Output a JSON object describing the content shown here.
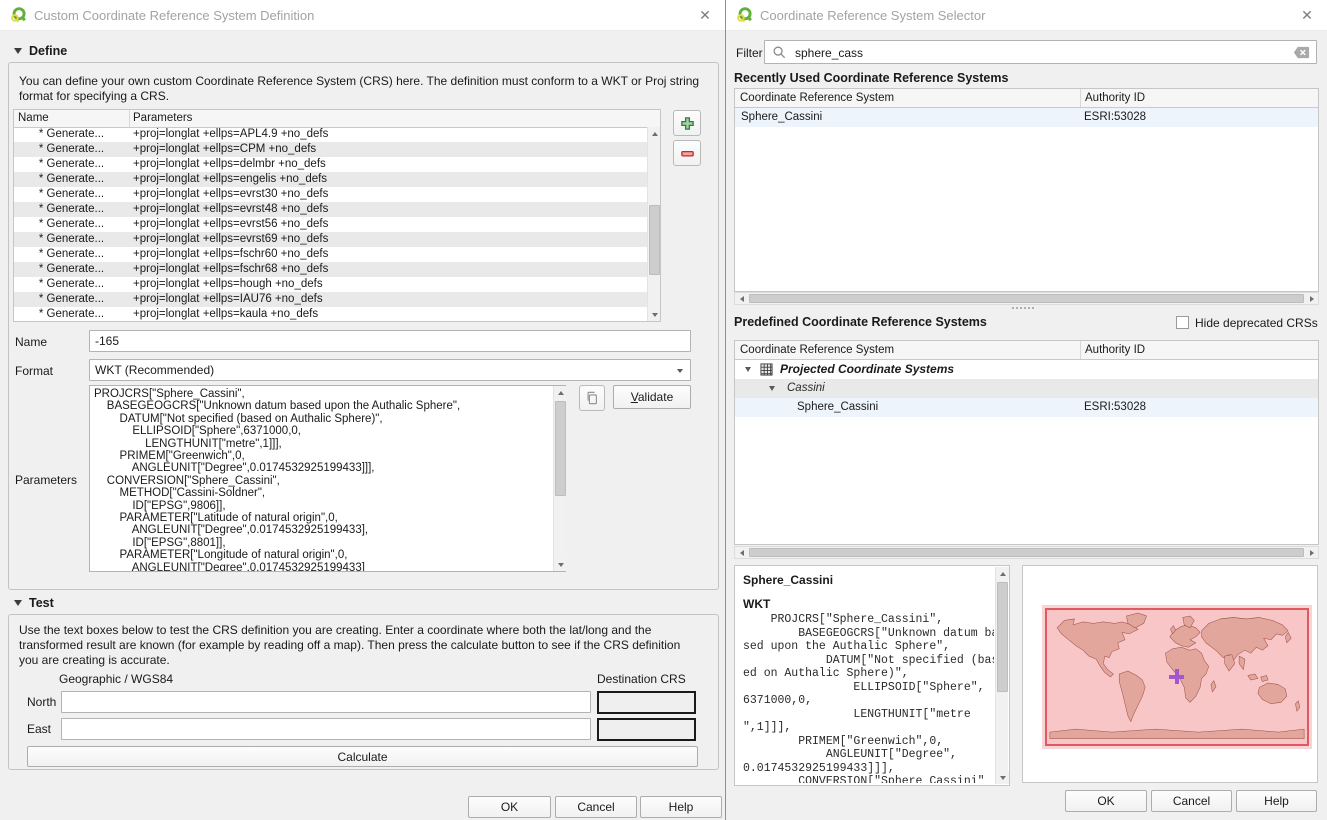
{
  "colors": {
    "qgis_green": "#60b03c",
    "qgis_yellow": "#e8d83a",
    "add_green": "#357a38",
    "remove_red": "#c62828",
    "selection_blue": "#eef4fb",
    "map_ocean_pink": "#f8c6c6",
    "map_land_pink": "#e2a69d",
    "map_border": "#9a4f46",
    "map_frame_red": "#e0595e",
    "crosshair_purple": "#a356cf"
  },
  "icons": {
    "close_glyph": "✕"
  },
  "left_dialog": {
    "title": "Custom Coordinate Reference System Definition",
    "define": {
      "header": "Define",
      "description": "You can define your own custom Coordinate Reference System (CRS) here. The definition must conform to a WKT or Proj string format for specifying a CRS.",
      "columns": [
        "Name",
        "Parameters"
      ],
      "rows": [
        {
          "name": "* Generate...",
          "parameters": "+proj=longlat +ellps=APL4.9 +no_defs"
        },
        {
          "name": "* Generate...",
          "parameters": "+proj=longlat +ellps=CPM +no_defs"
        },
        {
          "name": "* Generate...",
          "parameters": "+proj=longlat +ellps=delmbr +no_defs"
        },
        {
          "name": "* Generate...",
          "parameters": "+proj=longlat +ellps=engelis +no_defs"
        },
        {
          "name": "* Generate...",
          "parameters": "+proj=longlat +ellps=evrst30 +no_defs"
        },
        {
          "name": "* Generate...",
          "parameters": "+proj=longlat +ellps=evrst48 +no_defs"
        },
        {
          "name": "* Generate...",
          "parameters": "+proj=longlat +ellps=evrst56 +no_defs"
        },
        {
          "name": "* Generate...",
          "parameters": "+proj=longlat +ellps=evrst69 +no_defs"
        },
        {
          "name": "* Generate...",
          "parameters": "+proj=longlat +ellps=fschr60 +no_defs"
        },
        {
          "name": "* Generate...",
          "parameters": "+proj=longlat +ellps=fschr68 +no_defs"
        },
        {
          "name": "* Generate...",
          "parameters": "+proj=longlat +ellps=hough +no_defs"
        },
        {
          "name": "* Generate...",
          "parameters": "+proj=longlat +ellps=IAU76 +no_defs"
        },
        {
          "name": "* Generate...",
          "parameters": "+proj=longlat +ellps=kaula +no_defs"
        }
      ],
      "name_label": "Name",
      "name_value": "-165",
      "format_label": "Format",
      "format_value": "WKT (Recommended)",
      "parameters_label": "Parameters",
      "parameters_wkt": "PROJCRS[\"Sphere_Cassini\",\n    BASEGEOGCRS[\"Unknown datum based upon the Authalic Sphere\",\n        DATUM[\"Not specified (based on Authalic Sphere)\",\n            ELLIPSOID[\"Sphere\",6371000,0,\n                LENGTHUNIT[\"metre\",1]]],\n        PRIMEM[\"Greenwich\",0,\n            ANGLEUNIT[\"Degree\",0.0174532925199433]]],\n    CONVERSION[\"Sphere_Cassini\",\n        METHOD[\"Cassini-Soldner\",\n            ID[\"EPSG\",9806]],\n        PARAMETER[\"Latitude of natural origin\",0,\n            ANGLEUNIT[\"Degree\",0.0174532925199433],\n            ID[\"EPSG\",8801]],\n        PARAMETER[\"Longitude of natural origin\",0,\n            ANGLEUNIT[\"Degree\",0.0174532925199433]",
      "validate_label": "Validate"
    },
    "test": {
      "header": "Test",
      "description": "Use the text boxes below to test the CRS definition you are creating. Enter a coordinate where both the lat/long and the transformed result are known (for example by reading off a map). Then press the calculate button to see if the CRS definition you are creating is accurate.",
      "geographic_label": "Geographic / WGS84",
      "destination_label": "Destination CRS",
      "north_label": "North",
      "east_label": "East",
      "calculate_label": "Calculate"
    },
    "buttons": {
      "ok": "OK",
      "cancel": "Cancel",
      "help": "Help"
    }
  },
  "right_dialog": {
    "title": "Coordinate Reference System Selector",
    "filter": {
      "label": "Filter",
      "value": "sphere_cass"
    },
    "recent": {
      "heading": "Recently Used Coordinate Reference Systems",
      "columns": [
        "Coordinate Reference System",
        "Authority ID"
      ],
      "rows": [
        {
          "crs": "Sphere_Cassini",
          "authority": "ESRI:53028"
        }
      ]
    },
    "predefined": {
      "heading": "Predefined Coordinate Reference Systems",
      "hide_deprecated_label": "Hide deprecated CRSs",
      "columns": [
        "Coordinate Reference System",
        "Authority ID"
      ],
      "group_label": "Projected Coordinate Systems",
      "subgroup_label": "Cassini",
      "item": {
        "crs": "Sphere_Cassini",
        "authority": "ESRI:53028"
      }
    },
    "preview": {
      "name": "Sphere_Cassini",
      "wkt_label": "WKT",
      "wkt_text": "    PROJCRS[\"Sphere_Cassini\",\n        BASEGEOGCRS[\"Unknown datum ba\nsed upon the Authalic Sphere\",\n            DATUM[\"Not specified (bas\ned on Authalic Sphere)\",\n                ELLIPSOID[\"Sphere\",\n6371000,0,\n                LENGTHUNIT[\"metre\n\",1]]],\n        PRIMEM[\"Greenwich\",0,\n            ANGLEUNIT[\"Degree\",\n0.0174532925199433]]],\n        CONVERSION[\"Sphere_Cassini\""
    },
    "buttons": {
      "ok": "OK",
      "cancel": "Cancel",
      "help": "Help"
    }
  }
}
